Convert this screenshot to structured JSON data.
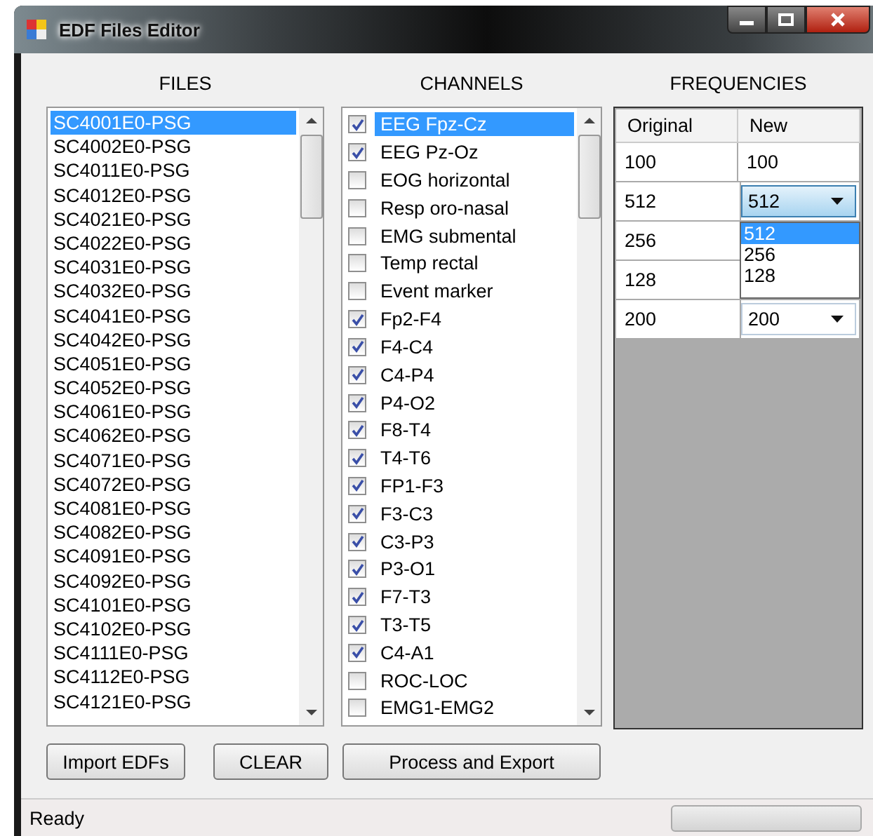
{
  "window": {
    "title": "EDF Files Editor"
  },
  "files": {
    "heading": "FILES",
    "items": [
      {
        "name": "SC4001E0-PSG",
        "selected": true
      },
      {
        "name": "SC4002E0-PSG",
        "selected": false
      },
      {
        "name": "SC4011E0-PSG",
        "selected": false
      },
      {
        "name": "SC4012E0-PSG",
        "selected": false
      },
      {
        "name": "SC4021E0-PSG",
        "selected": false
      },
      {
        "name": "SC4022E0-PSG",
        "selected": false
      },
      {
        "name": "SC4031E0-PSG",
        "selected": false
      },
      {
        "name": "SC4032E0-PSG",
        "selected": false
      },
      {
        "name": "SC4041E0-PSG",
        "selected": false
      },
      {
        "name": "SC4042E0-PSG",
        "selected": false
      },
      {
        "name": "SC4051E0-PSG",
        "selected": false
      },
      {
        "name": "SC4052E0-PSG",
        "selected": false
      },
      {
        "name": "SC4061E0-PSG",
        "selected": false
      },
      {
        "name": "SC4062E0-PSG",
        "selected": false
      },
      {
        "name": "SC4071E0-PSG",
        "selected": false
      },
      {
        "name": "SC4072E0-PSG",
        "selected": false
      },
      {
        "name": "SC4081E0-PSG",
        "selected": false
      },
      {
        "name": "SC4082E0-PSG",
        "selected": false
      },
      {
        "name": "SC4091E0-PSG",
        "selected": false
      },
      {
        "name": "SC4092E0-PSG",
        "selected": false
      },
      {
        "name": "SC4101E0-PSG",
        "selected": false
      },
      {
        "name": "SC4102E0-PSG",
        "selected": false
      },
      {
        "name": "SC4111E0-PSG",
        "selected": false
      },
      {
        "name": "SC4112E0-PSG",
        "selected": false
      },
      {
        "name": "SC4121E0-PSG",
        "selected": false
      }
    ]
  },
  "channels": {
    "heading": "CHANNELS",
    "items": [
      {
        "name": "EEG Fpz-Cz",
        "checked": true,
        "selected": true
      },
      {
        "name": "EEG Pz-Oz",
        "checked": true,
        "selected": false
      },
      {
        "name": "EOG horizontal",
        "checked": false,
        "selected": false
      },
      {
        "name": "Resp oro-nasal",
        "checked": false,
        "selected": false
      },
      {
        "name": "EMG submental",
        "checked": false,
        "selected": false
      },
      {
        "name": "Temp rectal",
        "checked": false,
        "selected": false
      },
      {
        "name": "Event marker",
        "checked": false,
        "selected": false
      },
      {
        "name": "Fp2-F4",
        "checked": true,
        "selected": false
      },
      {
        "name": "F4-C4",
        "checked": true,
        "selected": false
      },
      {
        "name": "C4-P4",
        "checked": true,
        "selected": false
      },
      {
        "name": "P4-O2",
        "checked": true,
        "selected": false
      },
      {
        "name": "F8-T4",
        "checked": true,
        "selected": false
      },
      {
        "name": "T4-T6",
        "checked": true,
        "selected": false
      },
      {
        "name": "FP1-F3",
        "checked": true,
        "selected": false
      },
      {
        "name": "F3-C3",
        "checked": true,
        "selected": false
      },
      {
        "name": "C3-P3",
        "checked": true,
        "selected": false
      },
      {
        "name": "P3-O1",
        "checked": true,
        "selected": false
      },
      {
        "name": "F7-T3",
        "checked": true,
        "selected": false
      },
      {
        "name": "T3-T5",
        "checked": true,
        "selected": false
      },
      {
        "name": "C4-A1",
        "checked": true,
        "selected": false
      },
      {
        "name": "ROC-LOC",
        "checked": false,
        "selected": false
      },
      {
        "name": "EMG1-EMG2",
        "checked": false,
        "selected": false
      }
    ]
  },
  "frequencies": {
    "heading": "FREQUENCIES",
    "columns": [
      "Original",
      "New"
    ],
    "rows": [
      {
        "original": "100",
        "kind": "text",
        "new": "100"
      },
      {
        "original": "512",
        "kind": "combo",
        "new": "512",
        "focused": true
      },
      {
        "original": "256",
        "kind": "hidden"
      },
      {
        "original": "128",
        "kind": "hidden"
      },
      {
        "original": "200",
        "kind": "combo",
        "new": "200",
        "focused": false
      }
    ],
    "dropdown": [
      {
        "label": "512",
        "selected": true
      },
      {
        "label": "256",
        "selected": false
      },
      {
        "label": "128",
        "selected": false
      }
    ]
  },
  "buttons": [
    {
      "label": "Import EDFs"
    },
    {
      "label": "CLEAR"
    },
    {
      "label": "Process and Export"
    }
  ],
  "status_bar": {
    "text": "Ready",
    "progress": {
      "level": 0
    }
  }
}
